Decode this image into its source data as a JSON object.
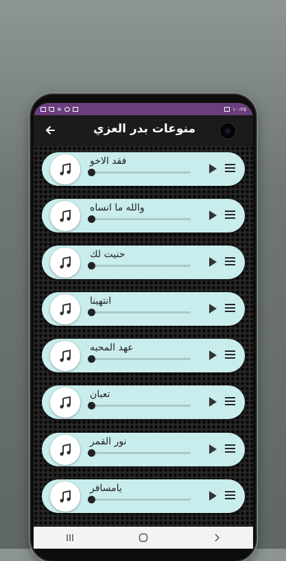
{
  "status_bar": {
    "time": "١٠:٢٥"
  },
  "app_bar": {
    "title": "منوعات بدر العزي"
  },
  "tracks": [
    {
      "title": "فقد الاخو",
      "progress": 0
    },
    {
      "title": "والله ما انساه",
      "progress": 0
    },
    {
      "title": "حنيت لك",
      "progress": 0
    },
    {
      "title": "انتهينا",
      "progress": 0
    },
    {
      "title": "عهد المحبه",
      "progress": 0
    },
    {
      "title": "تعبان",
      "progress": 0
    },
    {
      "title": "نور القمر",
      "progress": 0
    },
    {
      "title": "يامسافر",
      "progress": 0
    }
  ],
  "icons": {
    "back": "arrow-left-icon",
    "track": "music-note-icon",
    "play": "play-icon",
    "menu": "menu-icon",
    "nav": [
      "recent-apps-icon",
      "home-icon",
      "back-nav-icon"
    ]
  },
  "colors": {
    "status_bar": "#6a3d7d",
    "app_bar": "#1b1b1b",
    "card": "#c9ecec",
    "nav_bar": "#f3f3f3"
  }
}
